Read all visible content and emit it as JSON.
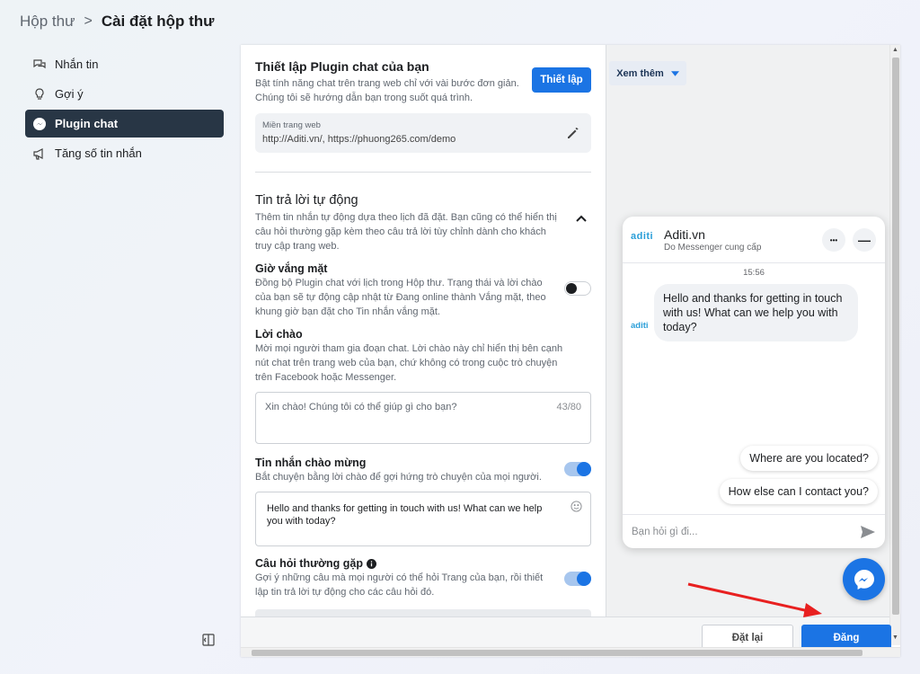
{
  "breadcrumb": {
    "root": "Hộp thư",
    "separator": ">",
    "current": "Cài đặt hộp thư"
  },
  "sidebar": {
    "items": [
      {
        "label": "Nhắn tin",
        "icon": "chat-bubbles-icon",
        "active": false
      },
      {
        "label": "Gợi ý",
        "icon": "lightbulb-icon",
        "active": false
      },
      {
        "label": "Plugin chat",
        "icon": "messenger-icon",
        "active": true
      },
      {
        "label": "Tăng số tin nhắn",
        "icon": "megaphone-icon",
        "active": false
      }
    ]
  },
  "setup": {
    "title": "Thiết lập Plugin chat của bạn",
    "desc": "Bật tính năng chat trên trang web chỉ với vài bước đơn giản. Chúng tôi sẽ hướng dẫn bạn trong suốt quá trình.",
    "button": "Thiết lập",
    "domain_label": "Miền trang web",
    "domain_value": "http://Aditi.vn/, https://phuong265.com/demo"
  },
  "autoreply": {
    "title": "Tin trả lời tự động",
    "desc": "Thêm tin nhắn tự động dựa theo lịch đã đặt. Bạn cũng có thể hiển thị câu hỏi thường gặp kèm theo câu trả lời tùy chỉnh dành cho khách truy cập trang web."
  },
  "away": {
    "title": "Giờ vắng mặt",
    "desc": "Đồng bộ Plugin chat với lịch trong Hộp thư. Trạng thái và lời chào của bạn sẽ tự động cập nhật từ Đang online thành Vắng mặt, theo khung giờ bạn đặt cho Tin nhắn vắng mặt.",
    "enabled": false
  },
  "greeting": {
    "title": "Lời chào",
    "desc": "Mời mọi người tham gia đoạn chat. Lời chào này chỉ hiển thị bên cạnh nút chat trên trang web của bạn, chứ không có trong cuộc trò chuyện trên Facebook hoặc Messenger.",
    "text": "Xin chào! Chúng tôi có thể giúp gì cho bạn?",
    "counter": "43/80"
  },
  "welcome": {
    "title": "Tin nhắn chào mừng",
    "desc": "Bắt chuyện bằng lời chào để gợi hứng trò chuyện của mọi người.",
    "enabled": true,
    "text": "Hello and thanks for getting in touch with us! What can we help you with today?"
  },
  "faq": {
    "title": "Câu hỏi thường gặp",
    "desc": "Gợi ý những câu mà mọi người có thể hỏi Trang của bạn, rồi thiết lập tin trả lời tự động cho các câu hỏi đó.",
    "enabled": true
  },
  "footer": {
    "reset": "Đặt lại",
    "post": "Đăng"
  },
  "preview": {
    "see_more": "Xem thêm",
    "chat": {
      "logo": "aditi",
      "name": "Aditi.vn",
      "subtitle": "Do Messenger cung cấp",
      "more_glyph": "•••",
      "minimize_glyph": "—",
      "time": "15:56",
      "message": "Hello and thanks for getting in touch with us! What can we help you with today?",
      "quick_replies": [
        "Where are you located?",
        "How else can I contact you?"
      ],
      "input_placeholder": "Bạn hỏi gì đi..."
    }
  },
  "colors": {
    "accent": "#1b74e4",
    "active_nav": "#283645",
    "annotation_arrow": "#e82020"
  }
}
